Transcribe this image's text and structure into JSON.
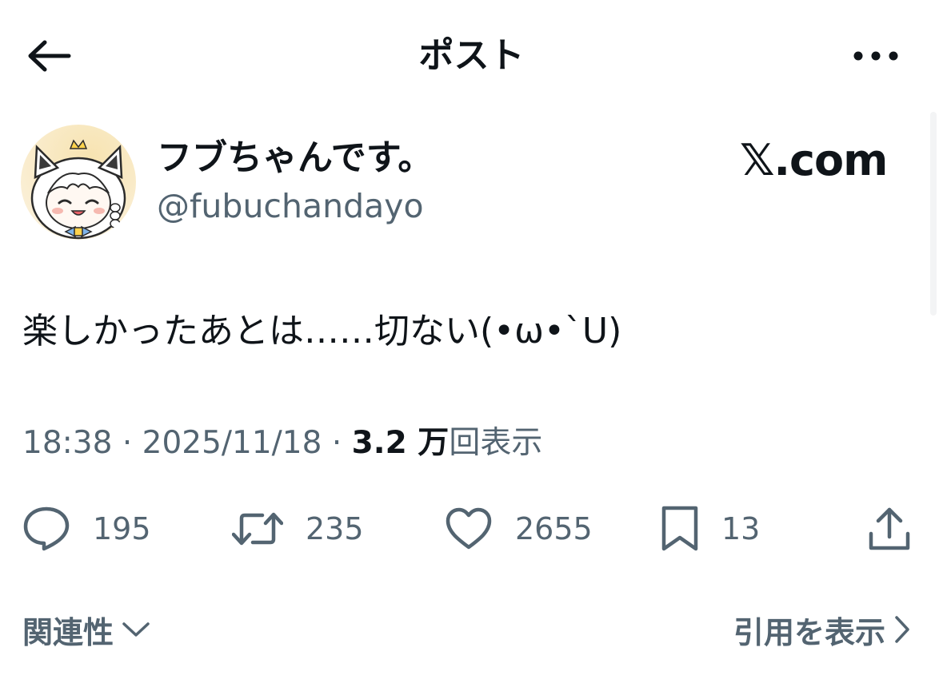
{
  "header": {
    "title": "ポスト",
    "back_icon": "arrow-left-icon",
    "more_icon": "more-horizontal-icon"
  },
  "author": {
    "display_name": "フブちゃんです。",
    "handle": "@fubuchandayo",
    "brand": "𝕏.com"
  },
  "post": {
    "text": "楽しかったあとは……切ない(•ω•`U)"
  },
  "meta": {
    "time": "18:38",
    "separator": "·",
    "date": "2025/11/18",
    "views_count": "3.2 万",
    "views_label": "回表示"
  },
  "actions": {
    "replies": "195",
    "reposts": "235",
    "likes": "2655",
    "bookmarks": "13"
  },
  "footer": {
    "relevance_label": "関連性",
    "quotes_label": "引用を表示"
  },
  "colors": {
    "text_primary": "#0f1419",
    "text_secondary": "#536471",
    "background": "#ffffff"
  }
}
